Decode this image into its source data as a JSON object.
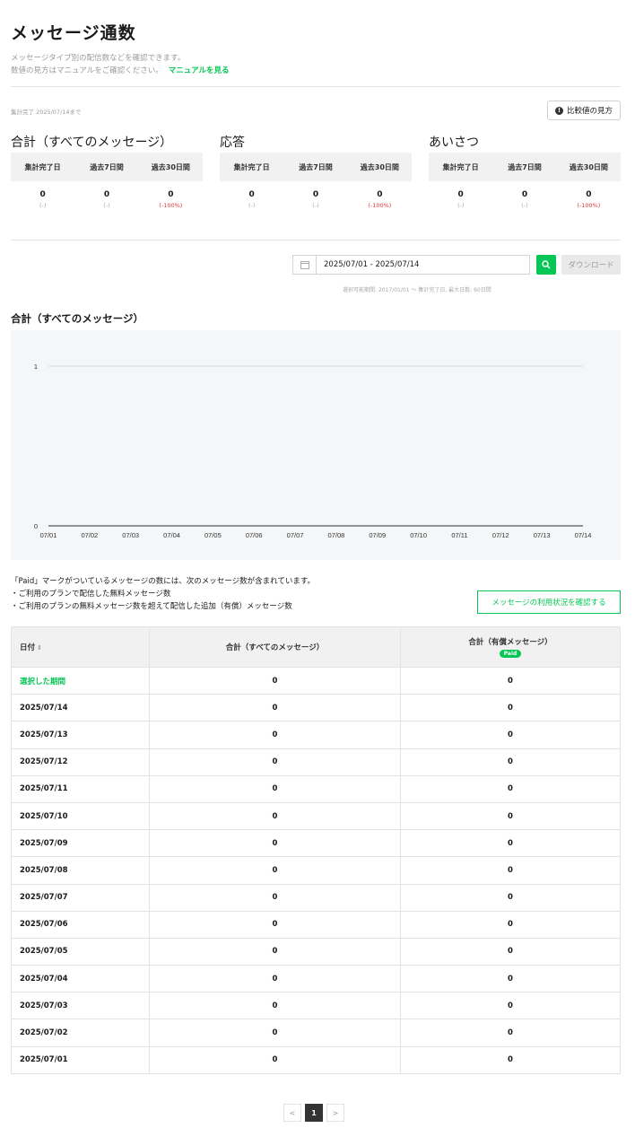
{
  "page": {
    "title": "メッセージ通数",
    "description_line1": "メッセージタイプ別の配信数などを確認できます。",
    "description_line2": "数値の見方はマニュアルをご確認ください。",
    "manual_link": "マニュアルを見る"
  },
  "summary": {
    "as_of": "集計完了 2025/07/14まで",
    "compare_button": "比較値の見方",
    "blocks": [
      {
        "title": "合計（すべてのメッセージ）",
        "headers": [
          "集計完了日",
          "過去7日間",
          "過去30日間"
        ],
        "values": [
          "0",
          "0",
          "0"
        ],
        "changes": [
          "(-)",
          "(-)",
          "(-100%)"
        ]
      },
      {
        "title": "応答",
        "headers": [
          "集計完了日",
          "過去7日間",
          "過去30日間"
        ],
        "values": [
          "0",
          "0",
          "0"
        ],
        "changes": [
          "(-)",
          "(-)",
          "(-100%)"
        ]
      },
      {
        "title": "あいさつ",
        "headers": [
          "集計完了日",
          "過去7日間",
          "過去30日間"
        ],
        "values": [
          "0",
          "0",
          "0"
        ],
        "changes": [
          "(-)",
          "(-)",
          "(-100%)"
        ]
      }
    ]
  },
  "filter": {
    "date_range": "2025/07/01 - 2025/07/14",
    "download_label": "ダウンロード",
    "range_note": "選択可能期間: 2017/01/01 ～ 集計完了日, 最大日数: 60日間"
  },
  "chart_data": {
    "type": "line",
    "title": "合計（すべてのメッセージ）",
    "x": [
      "07/01",
      "07/02",
      "07/03",
      "07/04",
      "07/05",
      "07/06",
      "07/07",
      "07/08",
      "07/09",
      "07/10",
      "07/11",
      "07/12",
      "07/13",
      "07/14"
    ],
    "series": [
      {
        "values": [
          0,
          0,
          0,
          0,
          0,
          0,
          0,
          0,
          0,
          0,
          0,
          0,
          0,
          0
        ]
      }
    ],
    "yticks": [
      "0",
      "1"
    ],
    "ylim": [
      0,
      1
    ],
    "grid": true,
    "line_color": "#555555"
  },
  "note": {
    "line1": "「Paid」マークがついているメッセージの数には、次のメッセージ数が含まれています。",
    "line2": "・ご利用のプランで配信した無料メッセージ数",
    "line3": "・ご利用のプランの無料メッセージ数を超えて配信した追加（有償）メッセージ数",
    "usage_button": "メッセージの利用状況を確認する"
  },
  "table": {
    "headers": [
      "日付",
      "合計（すべてのメッセージ）",
      "合計（有償メッセージ）"
    ],
    "paid_badge": "Paid",
    "sort_icon": "⇕",
    "rows": [
      [
        "選択した期間",
        "0",
        "0"
      ],
      [
        "2025/07/14",
        "0",
        "0"
      ],
      [
        "2025/07/13",
        "0",
        "0"
      ],
      [
        "2025/07/12",
        "0",
        "0"
      ],
      [
        "2025/07/11",
        "0",
        "0"
      ],
      [
        "2025/07/10",
        "0",
        "0"
      ],
      [
        "2025/07/09",
        "0",
        "0"
      ],
      [
        "2025/07/08",
        "0",
        "0"
      ],
      [
        "2025/07/07",
        "0",
        "0"
      ],
      [
        "2025/07/06",
        "0",
        "0"
      ],
      [
        "2025/07/05",
        "0",
        "0"
      ],
      [
        "2025/07/04",
        "0",
        "0"
      ],
      [
        "2025/07/03",
        "0",
        "0"
      ],
      [
        "2025/07/02",
        "0",
        "0"
      ],
      [
        "2025/07/01",
        "0",
        "0"
      ]
    ]
  },
  "pagination": {
    "prev": "<",
    "current": "1",
    "next": ">"
  },
  "colors": {
    "accent": "#06c755",
    "negative": "#e03a3a"
  }
}
